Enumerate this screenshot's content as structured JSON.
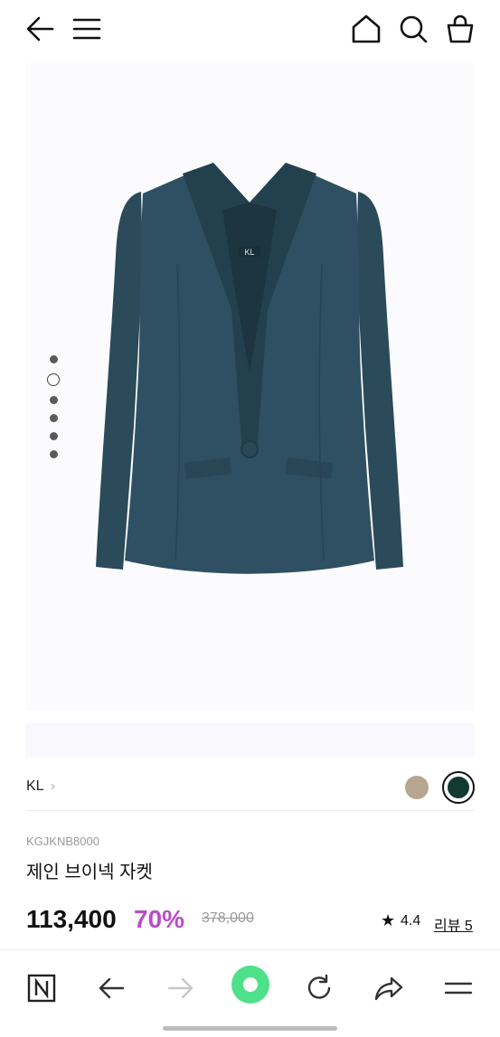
{
  "topbar": {
    "back_icon": "arrow-left-icon",
    "menu_icon": "hamburger-menu-icon",
    "home_icon": "home-icon",
    "search_icon": "search-icon",
    "cart_icon": "shopping-bag-icon"
  },
  "gallery": {
    "image": "navy-v-neck-jacket",
    "jacket_color": "#2b4a5a",
    "slide_count": 6,
    "active_index": 1
  },
  "brand": {
    "name": "KL",
    "chevron": "›",
    "swatches": [
      {
        "name": "beige",
        "color": "#b6a58f",
        "selected": false
      },
      {
        "name": "dark-green",
        "color": "#123a30",
        "selected": true
      }
    ]
  },
  "product": {
    "sku": "KGJKNB8000",
    "title": "제인 브이넥 자켓",
    "price": "113,400",
    "discount": "70%",
    "original_price": "378,000",
    "rating_star": "★",
    "rating": "4.4",
    "reviews": "리뷰 5",
    "discount_color": "#b84dc8"
  },
  "bottom_nav": {
    "icons": [
      "naver-n-icon",
      "back-arrow-icon",
      "forward-arrow-icon",
      "green-dot-icon",
      "refresh-icon",
      "share-icon",
      "menu-icon"
    ],
    "accent": "#4fe08a"
  }
}
